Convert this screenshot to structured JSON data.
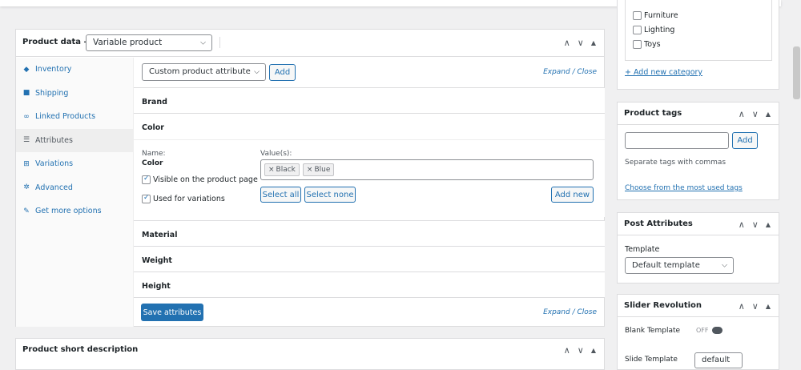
{
  "product_data": {
    "title": "Product data —",
    "type_select": "Variable product",
    "tabs": [
      {
        "label": "Inventory",
        "icon": "inventory-icon",
        "glyph": "◆"
      },
      {
        "label": "Shipping",
        "icon": "truck-icon",
        "glyph": "■"
      },
      {
        "label": "Linked Products",
        "icon": "link-icon",
        "glyph": "∞"
      },
      {
        "label": "Attributes",
        "icon": "list-icon",
        "glyph": "☰"
      },
      {
        "label": "Variations",
        "icon": "grid-icon",
        "glyph": "⊞"
      },
      {
        "label": "Advanced",
        "icon": "gear-icon",
        "glyph": "✲"
      },
      {
        "label": "Get more options",
        "icon": "plugin-icon",
        "glyph": "✎"
      }
    ],
    "active_tab": "Attributes",
    "attribute_select": "Custom product attribute",
    "add_button": "Add",
    "expand_close": "Expand / Close",
    "attributes": [
      "Brand",
      "Color",
      "Material",
      "Weight",
      "Height"
    ],
    "color_attr": {
      "name_label": "Name:",
      "name_value": "Color",
      "values_label": "Value(s):",
      "values": [
        "Black",
        "Blue"
      ],
      "visible_label": "Visible on the product page",
      "variations_label": "Used for variations",
      "select_all": "Select all",
      "select_none": "Select none",
      "add_new": "Add new"
    },
    "save_attributes": "Save attributes"
  },
  "short_description": {
    "title": "Product short description"
  },
  "categories": {
    "items": [
      "Furniture",
      "Lighting",
      "Toys"
    ],
    "add_new": "+ Add new category"
  },
  "product_tags": {
    "title": "Product tags",
    "add_button": "Add",
    "hint": "Separate tags with commas",
    "choose_link": "Choose from the most used tags"
  },
  "post_attributes": {
    "title": "Post Attributes",
    "template_label": "Template",
    "template_value": "Default template"
  },
  "slider_revolution": {
    "title": "Slider Revolution",
    "blank_template_label": "Blank Template",
    "toggle_state": "OFF",
    "slide_template_label": "Slide Template",
    "slide_template_value": "default"
  },
  "colors": {
    "accent": "#2271b1",
    "border": "#dcdcde",
    "background": "#f0f0f1"
  }
}
